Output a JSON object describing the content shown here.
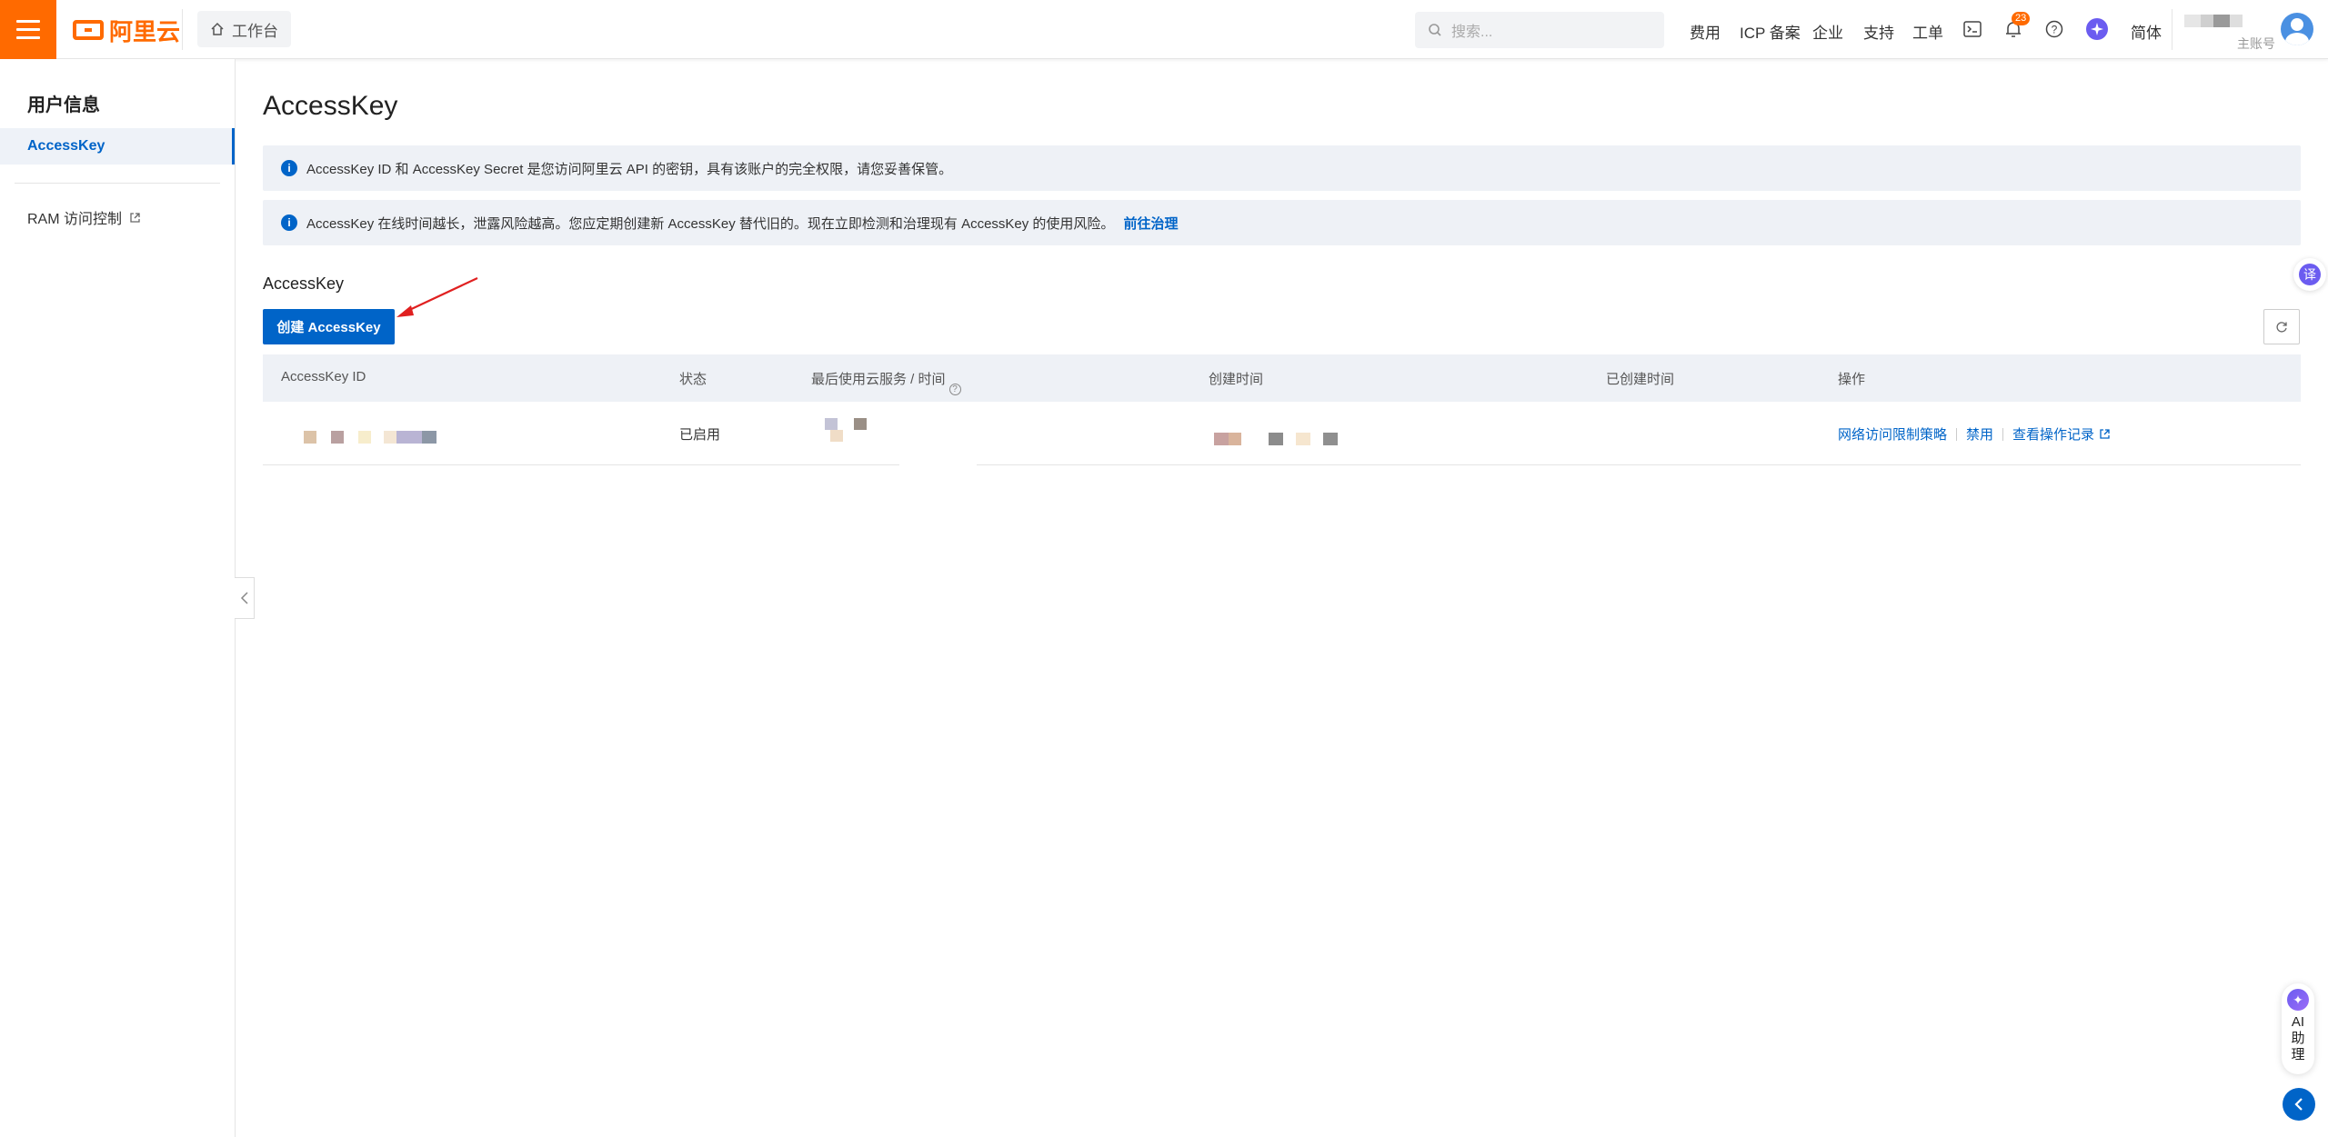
{
  "brand": {
    "logo_text": "阿里云",
    "accent": "#ff6a00",
    "primary": "#0064c8"
  },
  "topbar": {
    "workbench_label": "工作台",
    "search_placeholder": "搜索...",
    "nav": [
      "费用",
      "ICP 备案",
      "企业",
      "支持",
      "工单"
    ],
    "notification_count": "23",
    "language": "简体",
    "account_role": "主账号",
    "icons": [
      "terminal-icon",
      "bell-icon",
      "help-icon",
      "ai-assistant-icon"
    ]
  },
  "sidebar": {
    "title": "用户信息",
    "items": [
      {
        "label": "AccessKey",
        "active": true
      },
      {
        "label": "RAM 访问控制",
        "external": true
      }
    ]
  },
  "main": {
    "title": "AccessKey",
    "alerts": [
      {
        "text": "AccessKey ID 和 AccessKey Secret 是您访问阿里云 API 的密钥，具有该账户的完全权限，请您妥善保管。",
        "link": ""
      },
      {
        "text": "AccessKey 在线时间越长，泄露风险越高。您应定期创建新 AccessKey 替代旧的。现在立即检测和治理现有 AccessKey 的使用风险。",
        "link": "前往治理"
      }
    ],
    "section_title": "AccessKey",
    "create_button": "创建 AccessKey",
    "table": {
      "columns": [
        "AccessKey ID",
        "状态",
        "最后使用云服务 / 时间",
        "创建时间",
        "已创建时间",
        "操作"
      ],
      "rows": [
        {
          "status": "已启用",
          "actions": [
            "网络访问限制策略",
            "禁用",
            "查看操作记录"
          ]
        }
      ]
    }
  },
  "floating": {
    "translate_label": "译",
    "ai_label": "AI助理"
  }
}
